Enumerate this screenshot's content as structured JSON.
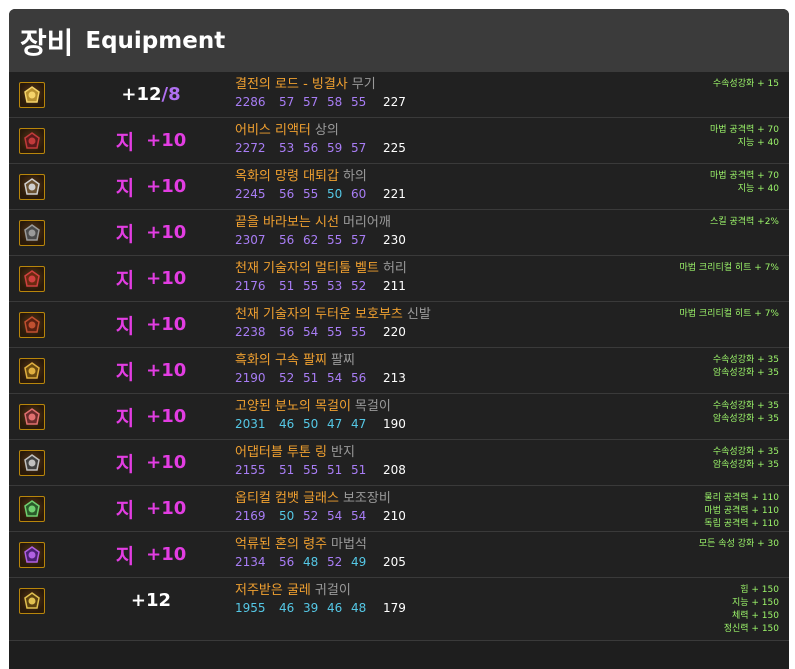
{
  "header": {
    "title_ko": "장비",
    "title_en": "Equipment"
  },
  "items": [
    {
      "icon": "sword-icon",
      "grade": {
        "tag": "",
        "plus": "+12",
        "slash": "/8",
        "pink": false
      },
      "name": "결전의 로드 - 빙결사",
      "slot": "무기",
      "stats": [
        {
          "v": "2286",
          "c": "purple"
        },
        {
          "v": "57",
          "c": "purple"
        },
        {
          "v": "57",
          "c": "purple"
        },
        {
          "v": "58",
          "c": "purple"
        },
        {
          "v": "55",
          "c": "purple"
        }
      ],
      "total": "227",
      "options": [
        "수속성강화 + 15"
      ]
    },
    {
      "icon": "armor-icon",
      "grade": {
        "tag": "지",
        "plus": "+10",
        "slash": "",
        "pink": true
      },
      "name": "어비스 리액터",
      "slot": "상의",
      "stats": [
        {
          "v": "2272",
          "c": "purple"
        },
        {
          "v": "53",
          "c": "purple"
        },
        {
          "v": "56",
          "c": "purple"
        },
        {
          "v": "59",
          "c": "purple"
        },
        {
          "v": "57",
          "c": "purple"
        }
      ],
      "total": "225",
      "options": [
        "마법 공격력 + 70",
        "지능 + 40"
      ]
    },
    {
      "icon": "pants-icon",
      "grade": {
        "tag": "지",
        "plus": "+10",
        "slash": "",
        "pink": true
      },
      "name": "옥화의 망령 대퇴갑",
      "slot": "하의",
      "stats": [
        {
          "v": "2245",
          "c": "purple"
        },
        {
          "v": "56",
          "c": "purple"
        },
        {
          "v": "55",
          "c": "purple"
        },
        {
          "v": "50",
          "c": "blue"
        },
        {
          "v": "60",
          "c": "purple"
        }
      ],
      "total": "221",
      "options": [
        "마법 공격력 + 70",
        "지능 + 40"
      ]
    },
    {
      "icon": "shoulder-icon",
      "grade": {
        "tag": "지",
        "plus": "+10",
        "slash": "",
        "pink": true
      },
      "name": "끝을 바라보는 시선",
      "slot": "머리어깨",
      "stats": [
        {
          "v": "2307",
          "c": "purple"
        },
        {
          "v": "56",
          "c": "purple"
        },
        {
          "v": "62",
          "c": "purple"
        },
        {
          "v": "55",
          "c": "purple"
        },
        {
          "v": "57",
          "c": "purple"
        }
      ],
      "total": "230",
      "options": [
        "스킬 공격력 +2%"
      ]
    },
    {
      "icon": "belt-icon",
      "grade": {
        "tag": "지",
        "plus": "+10",
        "slash": "",
        "pink": true
      },
      "name": "천재 기술자의 멀티툴 벨트",
      "slot": "허리",
      "stats": [
        {
          "v": "2176",
          "c": "purple"
        },
        {
          "v": "51",
          "c": "purple"
        },
        {
          "v": "55",
          "c": "purple"
        },
        {
          "v": "53",
          "c": "purple"
        },
        {
          "v": "52",
          "c": "purple"
        }
      ],
      "total": "211",
      "options": [
        "마법 크리티컬 히트 + 7%"
      ]
    },
    {
      "icon": "boots-icon",
      "grade": {
        "tag": "지",
        "plus": "+10",
        "slash": "",
        "pink": true
      },
      "name": "천재 기술자의 두터운 보호부츠",
      "slot": "신발",
      "stats": [
        {
          "v": "2238",
          "c": "purple"
        },
        {
          "v": "56",
          "c": "purple"
        },
        {
          "v": "54",
          "c": "purple"
        },
        {
          "v": "55",
          "c": "purple"
        },
        {
          "v": "55",
          "c": "purple"
        }
      ],
      "total": "220",
      "options": [
        "마법 크리티컬 히트 + 7%"
      ]
    },
    {
      "icon": "bracelet-icon",
      "grade": {
        "tag": "지",
        "plus": "+10",
        "slash": "",
        "pink": true
      },
      "name": "흑화의 구속 팔찌",
      "slot": "팔찌",
      "stats": [
        {
          "v": "2190",
          "c": "purple"
        },
        {
          "v": "52",
          "c": "purple"
        },
        {
          "v": "51",
          "c": "purple"
        },
        {
          "v": "54",
          "c": "purple"
        },
        {
          "v": "56",
          "c": "purple"
        }
      ],
      "total": "213",
      "options": [
        "수속성강화 + 35",
        "암속성강화 + 35"
      ]
    },
    {
      "icon": "necklace-icon",
      "grade": {
        "tag": "지",
        "plus": "+10",
        "slash": "",
        "pink": true
      },
      "name": "고양된 분노의 목걸이",
      "slot": "목걸이",
      "stats": [
        {
          "v": "2031",
          "c": "blue"
        },
        {
          "v": "46",
          "c": "blue"
        },
        {
          "v": "50",
          "c": "blue"
        },
        {
          "v": "47",
          "c": "blue"
        },
        {
          "v": "47",
          "c": "blue"
        }
      ],
      "total": "190",
      "options": [
        "수속성강화 + 35",
        "암속성강화 + 35"
      ]
    },
    {
      "icon": "ring-icon",
      "grade": {
        "tag": "지",
        "plus": "+10",
        "slash": "",
        "pink": true
      },
      "name": "어댑터블 투톤 링",
      "slot": "반지",
      "stats": [
        {
          "v": "2155",
          "c": "purple"
        },
        {
          "v": "51",
          "c": "purple"
        },
        {
          "v": "55",
          "c": "purple"
        },
        {
          "v": "51",
          "c": "purple"
        },
        {
          "v": "51",
          "c": "purple"
        }
      ],
      "total": "208",
      "options": [
        "수속성강화 + 35",
        "암속성강화 + 35"
      ]
    },
    {
      "icon": "glasses-icon",
      "grade": {
        "tag": "지",
        "plus": "+10",
        "slash": "",
        "pink": true
      },
      "name": "옵티컬 컴뱃 글래스",
      "slot": "보조장비",
      "stats": [
        {
          "v": "2169",
          "c": "purple"
        },
        {
          "v": "50",
          "c": "blue"
        },
        {
          "v": "52",
          "c": "purple"
        },
        {
          "v": "54",
          "c": "purple"
        },
        {
          "v": "54",
          "c": "purple"
        }
      ],
      "total": "210",
      "options": [
        "물리 공격력 + 110",
        "마법 공격력 + 110",
        "독립 공격력 + 110"
      ]
    },
    {
      "icon": "gem-icon",
      "grade": {
        "tag": "지",
        "plus": "+10",
        "slash": "",
        "pink": true
      },
      "name": "억류된 혼의 령주",
      "slot": "마법석",
      "stats": [
        {
          "v": "2134",
          "c": "purple"
        },
        {
          "v": "56",
          "c": "purple"
        },
        {
          "v": "48",
          "c": "blue"
        },
        {
          "v": "52",
          "c": "purple"
        },
        {
          "v": "49",
          "c": "blue"
        }
      ],
      "total": "205",
      "options": [
        "모든 속성 강화 + 30"
      ]
    },
    {
      "icon": "earring-icon",
      "grade": {
        "tag": "",
        "plus": "+12",
        "slash": "",
        "pink": false
      },
      "name": "저주받은 굴레",
      "slot": "귀걸이",
      "stats": [
        {
          "v": "1955",
          "c": "blue"
        },
        {
          "v": "46",
          "c": "blue"
        },
        {
          "v": "39",
          "c": "blue"
        },
        {
          "v": "46",
          "c": "blue"
        },
        {
          "v": "48",
          "c": "blue"
        }
      ],
      "total": "179",
      "options": [
        "힘 + 150",
        "지능 + 150",
        "체력 + 150",
        "정신력 + 150"
      ]
    }
  ]
}
